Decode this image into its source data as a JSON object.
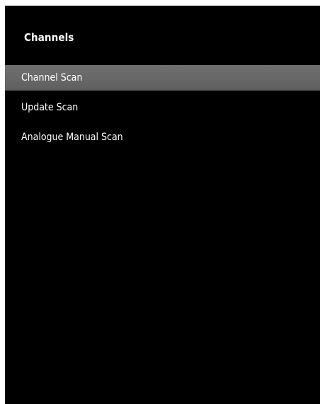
{
  "header": {
    "title": "Channels"
  },
  "menu": {
    "items": [
      {
        "label": "Channel Scan",
        "selected": true
      },
      {
        "label": "Update Scan",
        "selected": false
      },
      {
        "label": "Analogue Manual Scan",
        "selected": false
      }
    ]
  },
  "colors": {
    "background": "#000000",
    "text": "#ffffff",
    "highlight": "#666666"
  }
}
